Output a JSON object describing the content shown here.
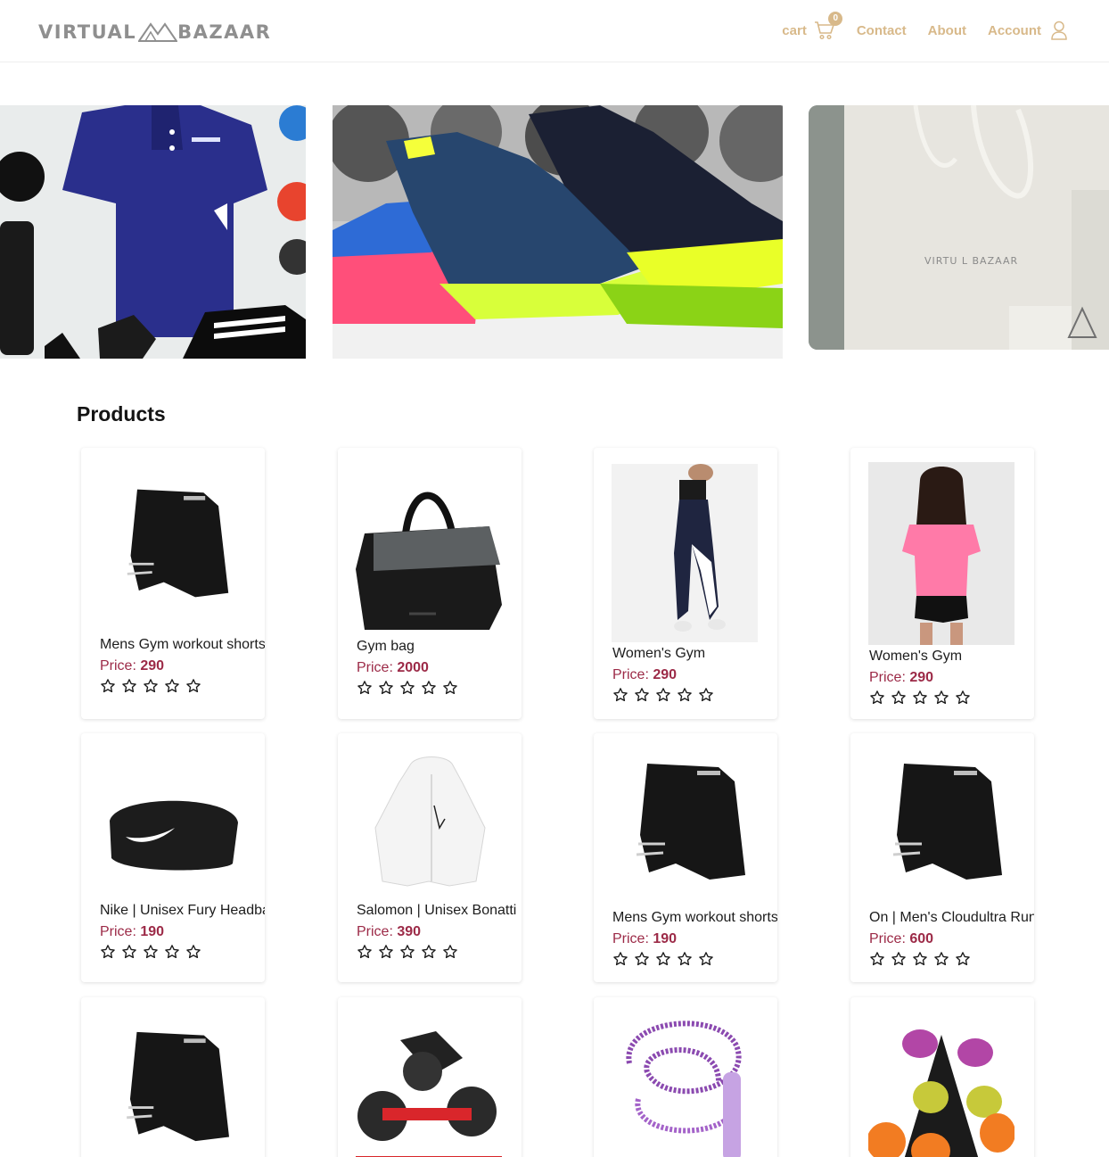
{
  "brand": {
    "left": "VIRTUAL",
    "right": "BAZAAR"
  },
  "nav": {
    "cart_label": "cart",
    "cart_count": "0",
    "contact_label": "Contact",
    "about_label": "About",
    "account_label": "Account"
  },
  "hero": {
    "slides": [
      {
        "name": "gym-apparel"
      },
      {
        "name": "sneakers"
      },
      {
        "name": "shopping-bag",
        "caption": "VIRTU  L BAZAAR"
      }
    ]
  },
  "products": {
    "title": "Products",
    "price_prefix": "Price:",
    "items": [
      {
        "name": "Mens Gym workout shorts",
        "price": "290",
        "image": "black-shorts",
        "rating": 0
      },
      {
        "name": "Gym bag",
        "price": "2000",
        "image": "gym-bag",
        "rating": 0
      },
      {
        "name": "Women's Gym",
        "price": "290",
        "image": "womens-leggings",
        "rating": 0
      },
      {
        "name": "Women's Gym",
        "price": "290",
        "image": "pink-tee",
        "rating": 0
      },
      {
        "name": "Nike | Unisex Fury Headband",
        "price": "190",
        "image": "headband",
        "rating": 0
      },
      {
        "name": "Salomon | Unisex Bonatti",
        "price": "390",
        "image": "white-jacket",
        "rating": 0
      },
      {
        "name": "Mens Gym workout shorts",
        "price": "190",
        "image": "black-shorts",
        "rating": 0
      },
      {
        "name": "On | Men's Cloudultra Run",
        "price": "600",
        "image": "black-shorts",
        "rating": 0
      },
      {
        "name": "",
        "price": "",
        "image": "black-shorts",
        "rating": 0
      },
      {
        "name": "",
        "price": "",
        "image": "dumbbell-set",
        "rating": 0
      },
      {
        "name": "",
        "price": "",
        "image": "jump-rope",
        "rating": 0
      },
      {
        "name": "",
        "price": "",
        "image": "dumbbell-rack",
        "rating": 0
      }
    ]
  },
  "colors": {
    "accent": "#d8b98a",
    "price": "#9c2a47",
    "logo": "#8f8f8f"
  }
}
